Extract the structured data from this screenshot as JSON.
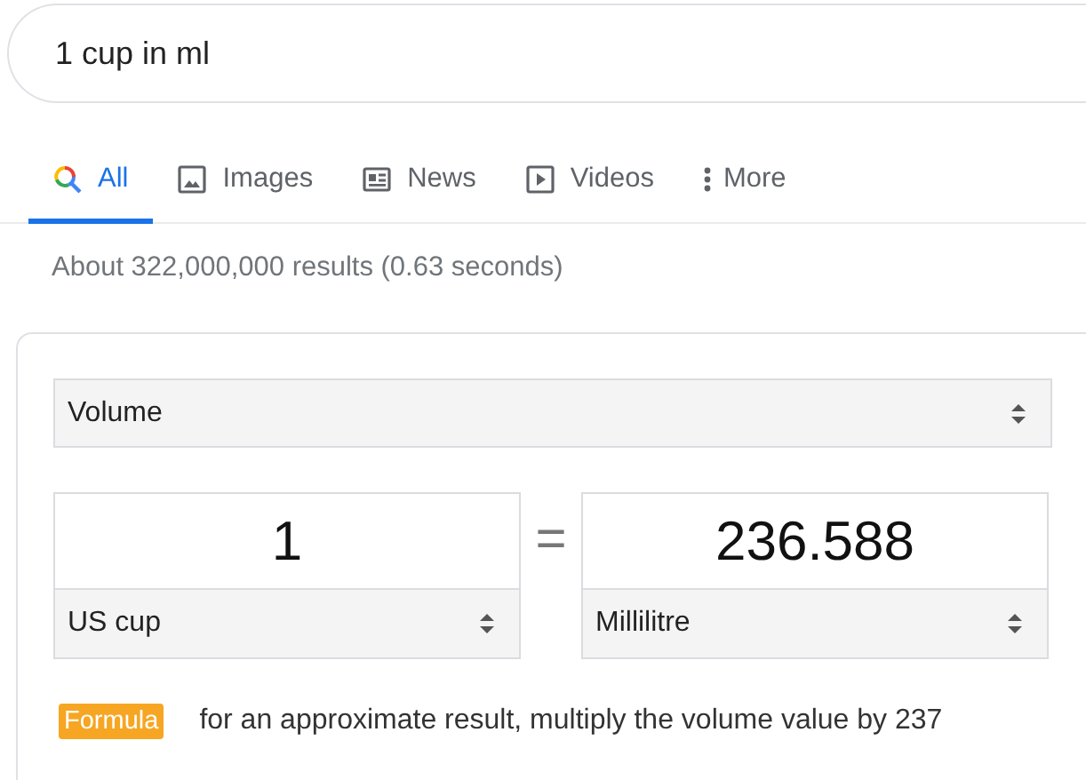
{
  "search": {
    "value": "1 cup in ml"
  },
  "tabs": [
    {
      "label": "All",
      "selected": true
    },
    {
      "label": "Images",
      "selected": false
    },
    {
      "label": "News",
      "selected": false
    },
    {
      "label": "Videos",
      "selected": false
    },
    {
      "label": "More",
      "selected": false
    }
  ],
  "result_stats": "About 322,000,000 results (0.63 seconds)",
  "converter": {
    "category": "Volume",
    "from": {
      "value": "1",
      "unit": "US cup"
    },
    "equals": "=",
    "to": {
      "value": "236.588",
      "unit": "Millilitre"
    },
    "formula": {
      "badge": "Formula",
      "text": "for an approximate result, multiply the volume value by 237"
    }
  }
}
